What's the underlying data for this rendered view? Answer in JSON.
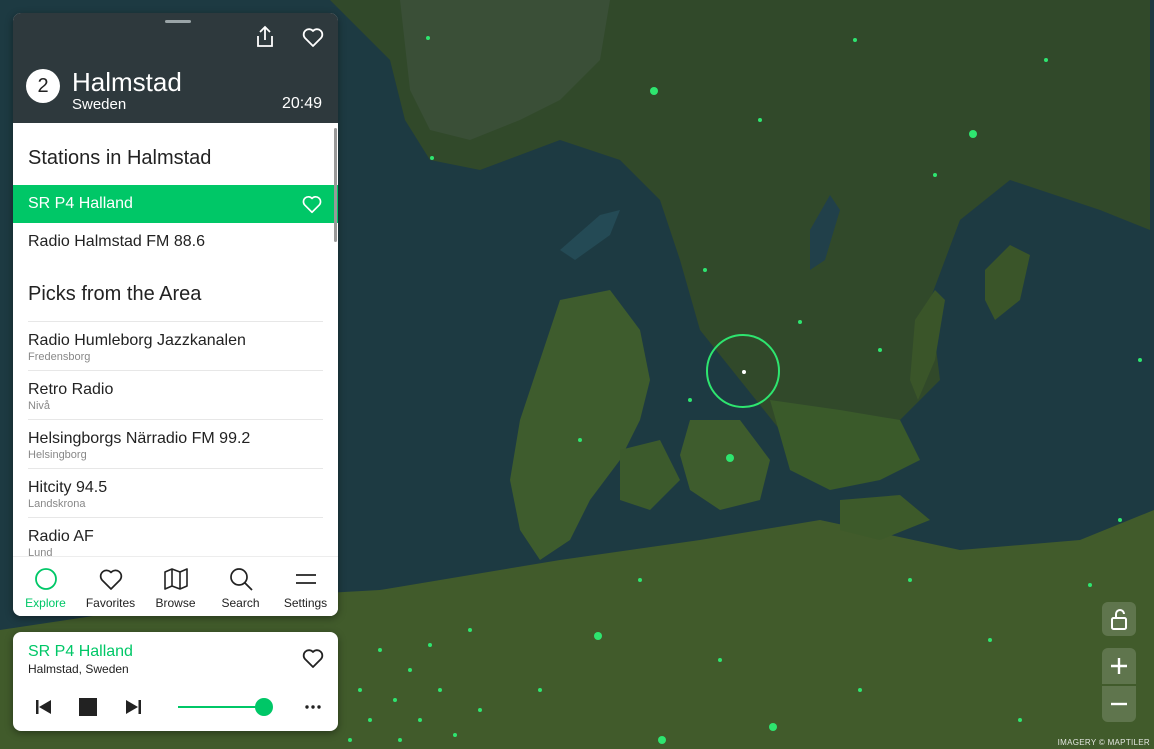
{
  "header": {
    "station_count": "2",
    "city": "Halmstad",
    "country": "Sweden",
    "local_time": "20:49"
  },
  "stations": {
    "title": "Stations in Halmstad",
    "items": [
      {
        "name": "SR P4 Halland",
        "active": true
      },
      {
        "name": "Radio Halmstad FM 88.6",
        "active": false
      }
    ]
  },
  "picks": {
    "title": "Picks from the Area",
    "items": [
      {
        "name": "Radio Humleborg Jazzkanalen",
        "location": "Fredensborg"
      },
      {
        "name": "Retro Radio",
        "location": "Nivå"
      },
      {
        "name": "Helsingborgs Närradio FM 99.2",
        "location": "Helsingborg"
      },
      {
        "name": "Hitcity 94.5",
        "location": "Landskrona"
      },
      {
        "name": "Radio AF",
        "location": "Lund"
      }
    ]
  },
  "tabs": [
    {
      "label": "Explore",
      "icon": "circle-icon",
      "active": true
    },
    {
      "label": "Favorites",
      "icon": "heart-icon",
      "active": false
    },
    {
      "label": "Browse",
      "icon": "map-icon",
      "active": false
    },
    {
      "label": "Search",
      "icon": "search-icon",
      "active": false
    },
    {
      "label": "Settings",
      "icon": "menu-icon",
      "active": false
    }
  ],
  "player": {
    "station": "SR P4 Halland",
    "location": "Halmstad, Sweden",
    "volume": 0.9
  },
  "map": {
    "attribution": "IMAGERY © MAPTILER"
  },
  "colors": {
    "accent": "#00c767",
    "marker": "#2ee56f",
    "panel_header": "#1c282c",
    "land": "#3c5a2c",
    "sea": "#1d3a42"
  }
}
